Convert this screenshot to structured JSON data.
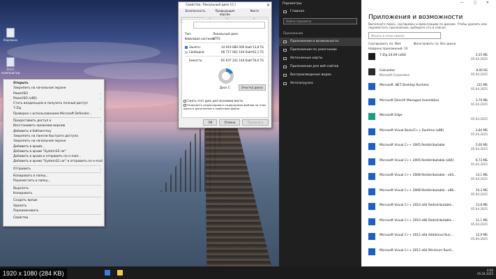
{
  "desktop": {
    "icons": [
      {
        "label": "Корзина",
        "icon": "recycle-bin-icon"
      },
      {
        "label": "Этот компьютер",
        "icon": "computer-icon"
      }
    ]
  },
  "context_menu": {
    "items": [
      {
        "label": "Открыть",
        "bold": true
      },
      {
        "label": "Закрепить на начальном экране"
      },
      {
        "label": "PowerISO",
        "submenu": true
      },
      {
        "label": "PowerISO (x86)",
        "submenu": true
      },
      {
        "label": "Стать владельцем и получить полный доступ"
      },
      {
        "label": "7-Zip",
        "submenu": true
      },
      {
        "label": "Проверка с использованием Microsoft Defender..."
      },
      {
        "sep": true
      },
      {
        "label": "Предоставить доступ к",
        "submenu": true
      },
      {
        "label": "Восстановить прежнюю версию"
      },
      {
        "label": "Добавить в библиотеку",
        "submenu": true
      },
      {
        "label": "Закрепить на панели быстрого доступа"
      },
      {
        "label": "Закрепить на начальном экране"
      },
      {
        "label": "Добавить в архив..."
      },
      {
        "label": "Добавить в архив \"System32.rar\""
      },
      {
        "label": "Добавить в архив и отправить по e-mail..."
      },
      {
        "label": "Добавить в архив \"System32.rar\" и отправить по e-mail"
      },
      {
        "sep": true
      },
      {
        "label": "Отправить",
        "submenu": true
      },
      {
        "sep": true
      },
      {
        "label": "Копировать в папку..."
      },
      {
        "label": "Переместить в папку..."
      },
      {
        "sep": true
      },
      {
        "label": "Вырезать"
      },
      {
        "label": "Копировать"
      },
      {
        "sep": true
      },
      {
        "label": "Создать ярлык"
      },
      {
        "label": "Удалить"
      },
      {
        "label": "Переименовать"
      },
      {
        "sep": true
      },
      {
        "label": "Свойства"
      }
    ]
  },
  "properties": {
    "title": "Свойства: Локальный диск (C:)",
    "tabs_top": [
      "Безопасность",
      "Предыдущие версии",
      "Квота"
    ],
    "tabs": [
      "Общие",
      "Сервис",
      "Оборудование",
      "Доступ"
    ],
    "type_label": "Тип:",
    "type_value": "Локальный диск",
    "fs_label": "Файловая система:",
    "fs_value": "NTFS",
    "used_label": "Занято:",
    "used_bytes": "14 919 680 000 байт",
    "used_gb": "13,8 ГБ",
    "free_label": "Свободно:",
    "free_bytes": "66 717 062 144 байт",
    "free_gb": "62,1 ГБ",
    "capacity_label": "Емкость:",
    "capacity_bytes": "81 637 242 144 байт",
    "capacity_gb": "76,0 ГБ",
    "used_fraction": 0.18,
    "colors": {
      "used": "#2b7bd6",
      "free": "#c9c9c9"
    },
    "disk_label": "Диск C:",
    "cleanup_button": "Очистка диска",
    "compress_check": "Сжать этот диск для экономии места",
    "index_check": "Разрешить индексировать содержимое файлов на этом диске в дополнение к свойствам файла",
    "ok": "ОК",
    "cancel": "Отмена",
    "apply": "Применить"
  },
  "settings": {
    "window_title": "Параметры",
    "home": "Главная",
    "search_placeholder": "Найти параметр",
    "section": "Приложения",
    "nav": [
      {
        "label": "Приложения и возможности",
        "active": true,
        "icon": "apps-list-icon"
      },
      {
        "label": "Приложения по умолчанию",
        "icon": "default-apps-icon"
      },
      {
        "label": "Автономные карты",
        "icon": "map-icon"
      },
      {
        "label": "Приложения для веб-сайтов",
        "icon": "web-icon"
      },
      {
        "label": "Воспроизведение видео",
        "icon": "video-icon"
      },
      {
        "label": "Автозагрузка",
        "icon": "startup-icon"
      }
    ],
    "heading": "Приложения и возможности",
    "description": "Выполните поиск, сортировку и фильтрацию по дискам. Чтобы удалить или переместить приложение, выберите его в списке.",
    "apps_search_placeholder": "Искать в этом списке",
    "sort_by": "Сортировать по: Имя",
    "filter_by": "Фильтровать по: Все диски",
    "found": "Найдено приложений: 16",
    "apps": [
      {
        "name": "7-Zip 24.09 (x64)",
        "size": "5,55 МБ",
        "date": "05.04.2025",
        "icon": "7zip-icon",
        "color": "#1b1b1b"
      },
      {
        "name": "Calculator",
        "size": "8,00 КБ",
        "publisher": "Microsoft Corporation",
        "date": "05.04.2025",
        "icon": "calculator-icon",
        "color": "#2a2a2a"
      },
      {
        "name": "Microsoft .NET Desktop Runtime",
        "size": "222 МБ",
        "date": "05.04.2025",
        "icon": "installer-icon",
        "color": "#1e5fbf"
      },
      {
        "name": "Microsoft DirectX Managed Assemblies",
        "size": "3,70 МБ",
        "date": "05.04.2025",
        "icon": "installer-icon",
        "color": "#1e5fbf"
      },
      {
        "name": "Microsoft Edge",
        "size": "",
        "date": "05.04.2025",
        "icon": "edge-icon",
        "color": "#1a9e7a"
      },
      {
        "name": "Microsoft Visual Basic/C++ Runtime (x86)",
        "size": "3,84 МБ",
        "date": "05.04.2025",
        "icon": "installer-icon",
        "color": "#1e5fbf"
      },
      {
        "name": "Microsoft Visual C++ 2005 Redistributable",
        "size": "5,00 МБ",
        "date": "05.04.2025",
        "icon": "installer-icon",
        "color": "#1e5fbf"
      },
      {
        "name": "Microsoft Visual C++ 2005 Redistributable (x64)",
        "size": "6,73 МБ",
        "date": "05.04.2025",
        "icon": "installer-icon",
        "color": "#1e5fbf"
      },
      {
        "name": "Microsoft Visual C++ 2008 Redistributable - x64...",
        "size": "13,1 МБ",
        "date": "05.04.2025",
        "icon": "installer-icon",
        "color": "#1e5fbf"
      },
      {
        "name": "Microsoft Visual C++ 2008 Redistributable - x86...",
        "size": "10,3 МБ",
        "date": "05.04.2025",
        "icon": "installer-icon",
        "color": "#1e5fbf"
      },
      {
        "name": "Microsoft Visual C++ 2010 x64 Redistributable...",
        "size": "13,8 МБ",
        "date": "05.04.2025",
        "icon": "installer-icon",
        "color": "#1e5fbf"
      },
      {
        "name": "Microsoft Visual C++ 2010 x86 Redistributable...",
        "size": "11,1 МБ",
        "date": "05.04.2025",
        "icon": "installer-icon",
        "color": "#1e5fbf"
      },
      {
        "name": "Microsoft Visual C++ 2012 x64 Additional Run...",
        "size": "12,9 МБ",
        "date": "05.04.2025",
        "icon": "installer-icon",
        "color": "#1e5fbf"
      },
      {
        "name": "Microsoft Visual C++ 2012 x64 Minimum Runti...",
        "size": "",
        "date": "",
        "icon": "installer-icon",
        "color": "#1e5fbf"
      }
    ]
  },
  "taskbar": {
    "time": "4:00",
    "date": "05.04.2025"
  },
  "caption": "1920 x 1080 (284 KB)"
}
